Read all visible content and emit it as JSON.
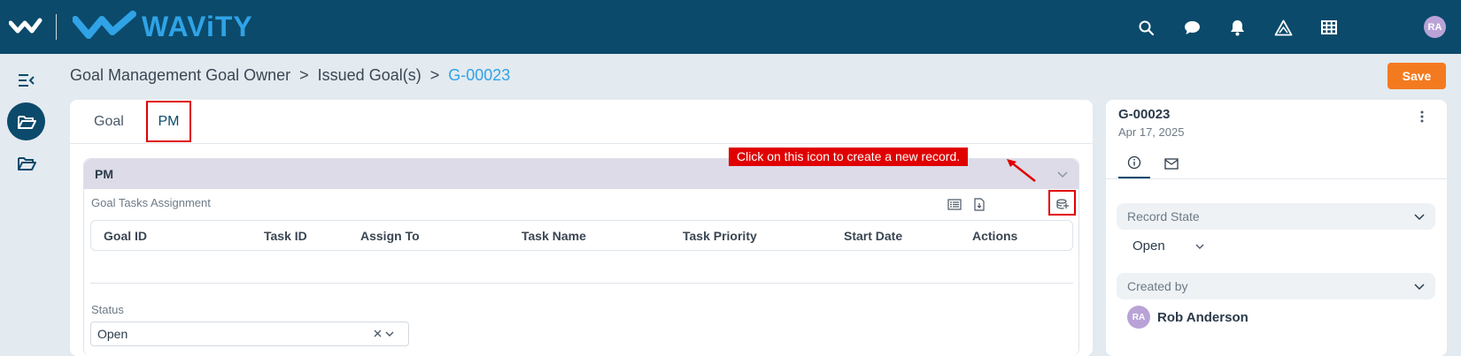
{
  "app": {
    "brand": "WAViTY",
    "accent_color": "#0b4a6b",
    "brand_color": "#2fa3e6",
    "save_color": "#f47a20",
    "user_initials": "RA"
  },
  "topbar_icons": [
    "search-icon",
    "chat-icon",
    "bell-icon",
    "alert-triangle-icon",
    "grid-icon"
  ],
  "sidebar": {
    "items": [
      {
        "icon": "collapse-menu-icon"
      },
      {
        "icon": "folder-open-icon",
        "active": true
      },
      {
        "icon": "folder-icon"
      }
    ]
  },
  "breadcrumb": {
    "items": [
      "Goal Management Goal Owner",
      "Issued Goal(s)"
    ],
    "separator": ">",
    "current": "G-00023"
  },
  "toolbar": {
    "save_label": "Save"
  },
  "tabs": [
    {
      "label": "Goal",
      "active": false
    },
    {
      "label": "PM",
      "active": true
    }
  ],
  "section": {
    "title": "PM",
    "subsection_title": "Goal Tasks Assignment",
    "tool_icons": [
      "list-view-icon",
      "export-file-icon",
      "create-record-icon"
    ],
    "table": {
      "columns": [
        "Goal ID",
        "Task ID",
        "Assign To",
        "Task Name",
        "Task Priority",
        "Start Date",
        "Actions"
      ],
      "rows": []
    },
    "status": {
      "label": "Status",
      "value": "Open"
    }
  },
  "annotation": {
    "callout_text": "Click on this icon to create a new record."
  },
  "record_panel": {
    "id": "G-00023",
    "date": "Apr 17, 2025",
    "tabs": [
      "info-icon",
      "mail-icon"
    ],
    "record_state": {
      "label": "Record State",
      "value": "Open"
    },
    "created_by": {
      "label": "Created by",
      "initials": "RA",
      "name": "Rob Anderson"
    }
  }
}
